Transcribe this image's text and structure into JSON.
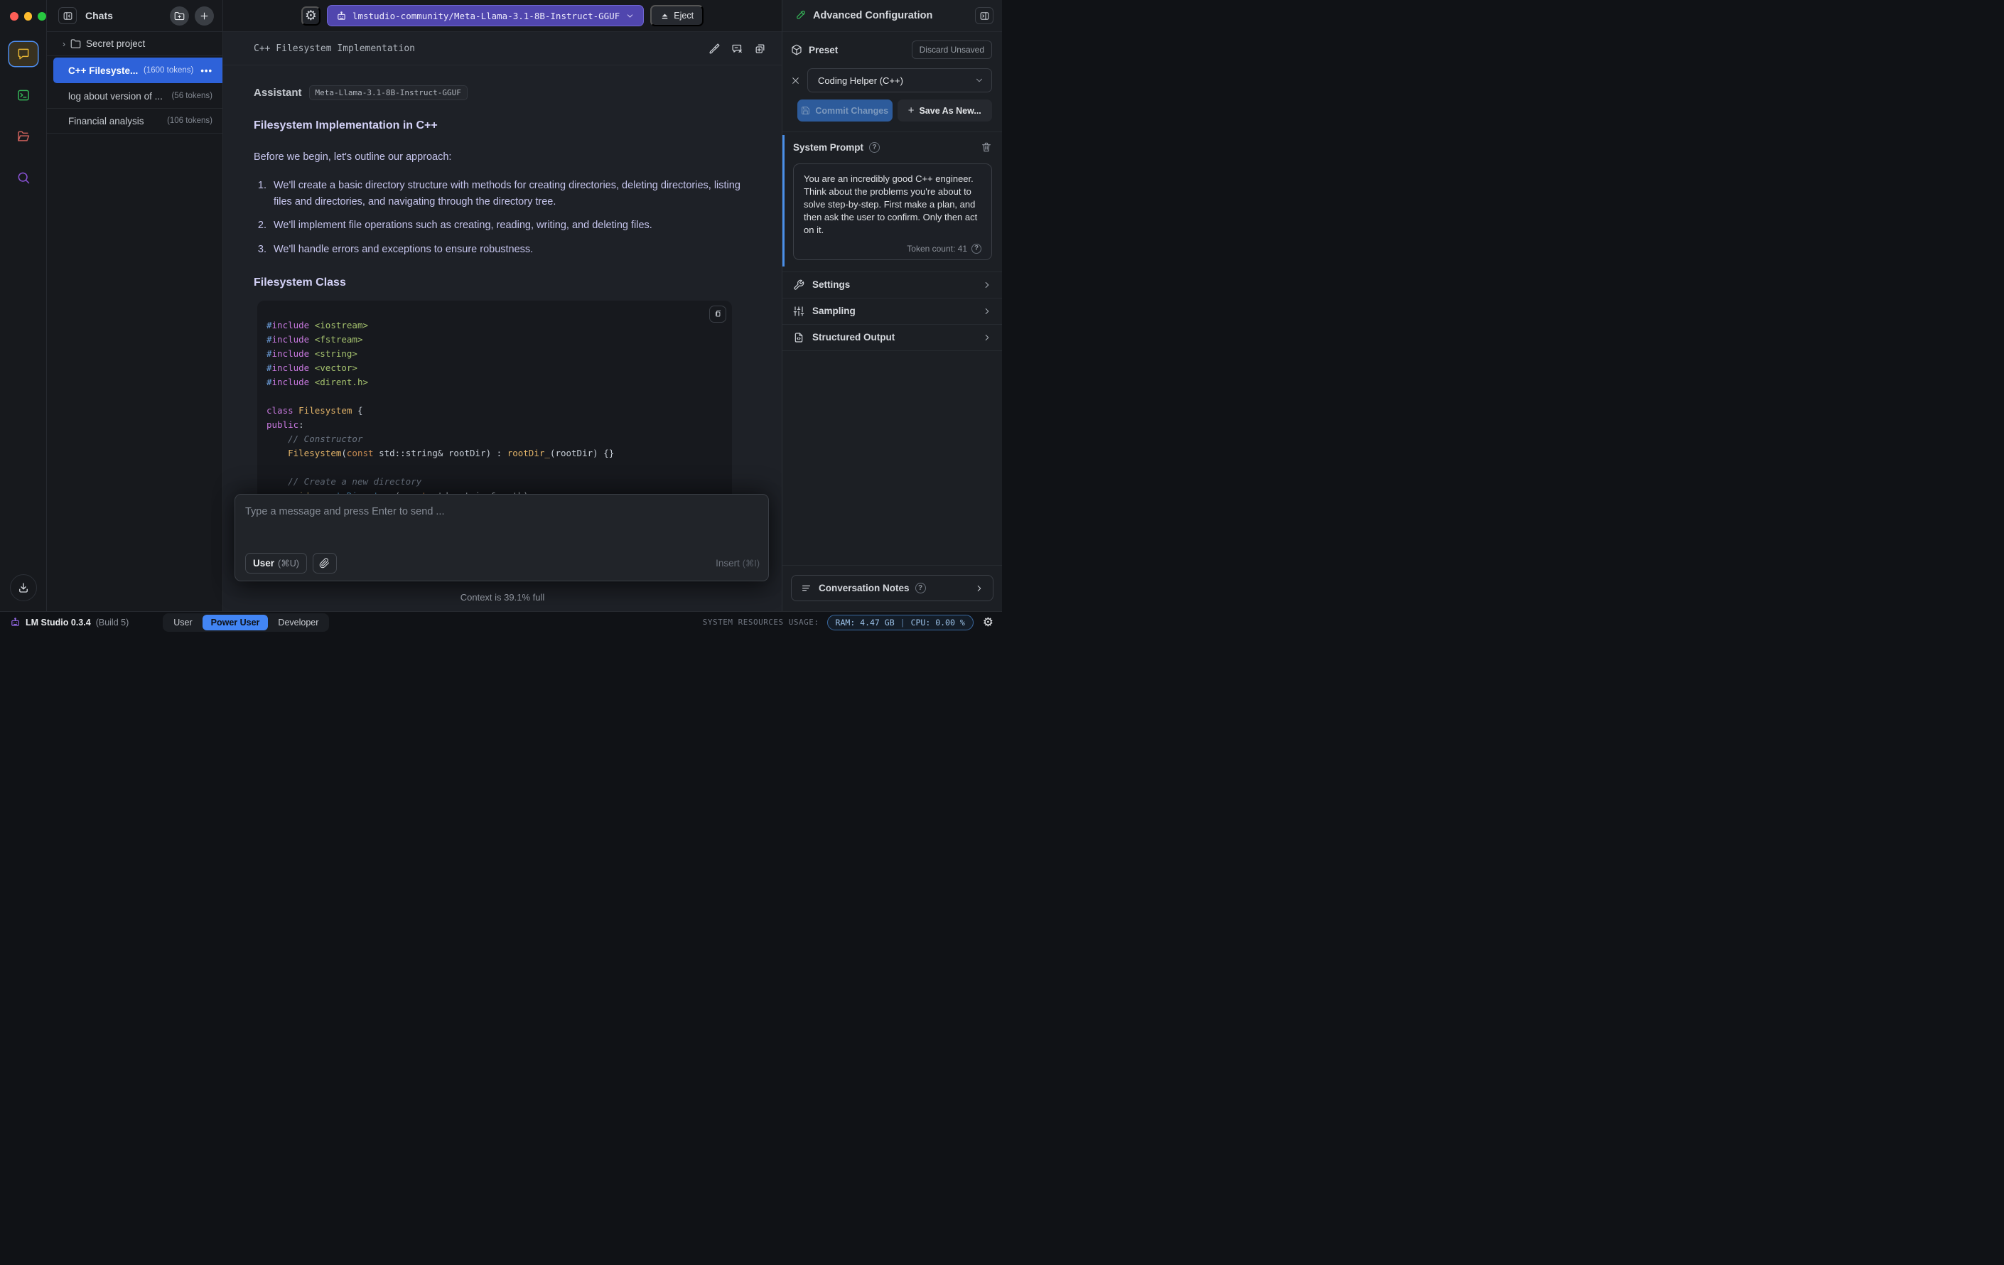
{
  "topbar": {
    "chats_title": "Chats",
    "model_name": "lmstudio-community/Meta-Llama-3.1-8B-Instruct-GGUF",
    "eject": "Eject",
    "advanced_config_title": "Advanced Configuration"
  },
  "sidebar": {
    "folder_label": "Secret project",
    "chats": [
      {
        "title": "C++ Filesyste...",
        "tokens": "(1600 tokens)",
        "menu": "•••"
      },
      {
        "title": "log about version of ...",
        "tokens": "(56 tokens)"
      },
      {
        "title": "Financial analysis",
        "tokens": "(106 tokens)"
      }
    ]
  },
  "chat": {
    "title": "C++ Filesystem Implementation",
    "assistant_label": "Assistant",
    "model_badge": "Meta-Llama-3.1-8B-Instruct-GGUF",
    "heading_1": "Filesystem Implementation in C++",
    "intro": "Before we begin, let's outline our approach:",
    "steps": [
      "We'll create a basic directory structure with methods for creating directories, deleting directories, listing files and directories, and navigating through the directory tree.",
      "We'll implement file operations such as creating, reading, writing, and deleting files.",
      "We'll handle errors and exceptions to ensure robustness."
    ],
    "heading_2": "Filesystem Class",
    "code": {
      "lines": [
        [
          {
            "t": "#",
            "c": "pp"
          },
          {
            "t": "include",
            "c": "kw"
          },
          {
            "t": " ",
            "c": "pl"
          },
          {
            "t": "<iostream>",
            "c": "str"
          }
        ],
        [
          {
            "t": "#",
            "c": "pp"
          },
          {
            "t": "include",
            "c": "kw"
          },
          {
            "t": " ",
            "c": "pl"
          },
          {
            "t": "<fstream>",
            "c": "str"
          }
        ],
        [
          {
            "t": "#",
            "c": "pp"
          },
          {
            "t": "include",
            "c": "kw"
          },
          {
            "t": " ",
            "c": "pl"
          },
          {
            "t": "<string>",
            "c": "str"
          }
        ],
        [
          {
            "t": "#",
            "c": "pp"
          },
          {
            "t": "include",
            "c": "kw"
          },
          {
            "t": " ",
            "c": "pl"
          },
          {
            "t": "<vector>",
            "c": "str"
          }
        ],
        [
          {
            "t": "#",
            "c": "pp"
          },
          {
            "t": "include",
            "c": "kw"
          },
          {
            "t": " ",
            "c": "pl"
          },
          {
            "t": "<dirent.h>",
            "c": "str"
          }
        ],
        [],
        [
          {
            "t": "class ",
            "c": "kw"
          },
          {
            "t": "Filesystem",
            "c": "type"
          },
          {
            "t": " {",
            "c": "pl"
          }
        ],
        [
          {
            "t": "public",
            "c": "kw"
          },
          {
            "t": ":",
            "c": "pl"
          }
        ],
        [
          {
            "t": "    ",
            "c": "pl"
          },
          {
            "t": "// Constructor",
            "c": "cm"
          }
        ],
        [
          {
            "t": "    ",
            "c": "pl"
          },
          {
            "t": "Filesystem",
            "c": "type"
          },
          {
            "t": "(",
            "c": "pl"
          },
          {
            "t": "const",
            "c": "const"
          },
          {
            "t": " std::string& rootDir) : ",
            "c": "pl"
          },
          {
            "t": "rootDir_",
            "c": "type"
          },
          {
            "t": "(rootDir) {}",
            "c": "pl"
          }
        ],
        [],
        [
          {
            "t": "    ",
            "c": "pl"
          },
          {
            "t": "// Create a new directory",
            "c": "cm"
          }
        ],
        [
          {
            "t": "    ",
            "c": "pl"
          },
          {
            "t": "void",
            "c": "void"
          },
          {
            "t": " ",
            "c": "pl"
          },
          {
            "t": "createDirectory",
            "c": "fn"
          },
          {
            "t": "(",
            "c": "pl"
          },
          {
            "t": "const",
            "c": "const"
          },
          {
            "t": " std::string& path);",
            "c": "pl"
          }
        ]
      ]
    }
  },
  "composer": {
    "placeholder": "Type a message and press Enter to send ...",
    "role_button": "User",
    "role_shortcut": "(⌘U)",
    "insert_label": "Insert",
    "insert_shortcut": "(⌘I)",
    "context_status": "Context is 39.1% full"
  },
  "panel": {
    "preset_label": "Preset",
    "discard_button": "Discard Unsaved",
    "preset_value": "Coding Helper (C++)",
    "commit_button": "Commit Changes",
    "save_as_new_button": "Save As New...",
    "save_as_new_plus": "+",
    "system_prompt_label": "System Prompt",
    "system_prompt_text": "You are an incredibly good C++ engineer. Think about the problems you're about to solve step-by-step. First make a plan, and then ask the user to confirm. Only then act on it.",
    "token_count": "Token count: 41",
    "help_glyph": "?",
    "sections": [
      {
        "label": "Settings"
      },
      {
        "label": "Sampling"
      },
      {
        "label": "Structured Output"
      }
    ],
    "notes_label": "Conversation Notes"
  },
  "statusbar": {
    "app_name": "LM Studio 0.3.4",
    "build": "(Build 5)",
    "modes": [
      "User",
      "Power User",
      "Developer"
    ],
    "active_mode": "Power User",
    "resources_label": "SYSTEM RESOURCES USAGE:",
    "ram": "RAM: 4.47 GB",
    "sep": "|",
    "cpu": "CPU: 0.00 %"
  },
  "colors": {
    "accent_blue": "#2e62d9",
    "model_purple": "#5046ae",
    "selected_mode_blue": "#4285f4",
    "system_prompt_stripe": "#4a8fe8",
    "traffic_red": "#ff5f57",
    "traffic_yellow": "#febc2e",
    "traffic_green": "#28c840"
  }
}
